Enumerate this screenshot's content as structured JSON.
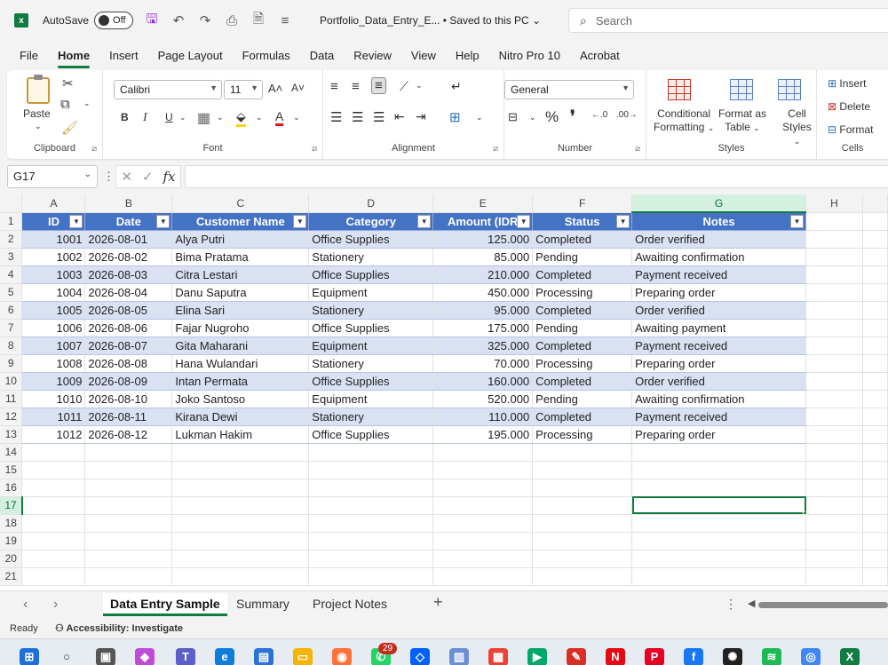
{
  "titlebar": {
    "autosave_label": "AutoSave",
    "autosave_state": "Off",
    "doc_title": "Portfolio_Data_Entry_E... • Saved to this PC",
    "search_placeholder": "Search"
  },
  "menu": [
    "File",
    "Home",
    "Insert",
    "Page Layout",
    "Formulas",
    "Data",
    "Review",
    "View",
    "Help",
    "Nitro Pro 10",
    "Acrobat"
  ],
  "ribbon": {
    "clipboard": {
      "label": "Clipboard",
      "paste": "Paste"
    },
    "font": {
      "label": "Font",
      "family": "Calibri",
      "size": "11",
      "bold": "B",
      "italic": "I",
      "underline": "U",
      "grow": "A˄",
      "shrink": "A˅"
    },
    "alignment": {
      "label": "Alignment"
    },
    "number": {
      "label": "Number",
      "format": "General",
      "percent": "%",
      "comma": "❜"
    },
    "styles": {
      "label": "Styles",
      "conditional": "Conditional",
      "conditional2": "Formatting",
      "format_table": "Format as",
      "format_table2": "Table",
      "cell_styles": "Cell",
      "cell_styles2": "Styles"
    },
    "cells": {
      "label": "Cells",
      "insert": "Insert",
      "delete": "Delete",
      "format": "Format"
    }
  },
  "formula_bar": {
    "name_box": "G17",
    "fx": "fx",
    "value": ""
  },
  "columns": [
    "A",
    "B",
    "C",
    "D",
    "E",
    "F",
    "G",
    "H"
  ],
  "selected_column": "G",
  "selected_row": 17,
  "table": {
    "headers": [
      "ID",
      "Date",
      "Customer Name",
      "Category",
      "Amount (IDR",
      "Status",
      "Notes"
    ],
    "rows": [
      [
        "1001",
        "2026-08-01",
        "Alya Putri",
        "Office Supplies",
        "125.000",
        "Completed",
        "Order verified"
      ],
      [
        "1002",
        "2026-08-02",
        "Bima Pratama",
        "Stationery",
        "85.000",
        "Pending",
        "Awaiting confirmation"
      ],
      [
        "1003",
        "2026-08-03",
        "Citra Lestari",
        "Office Supplies",
        "210.000",
        "Completed",
        "Payment received"
      ],
      [
        "1004",
        "2026-08-04",
        "Danu Saputra",
        "Equipment",
        "450.000",
        "Processing",
        "Preparing order"
      ],
      [
        "1005",
        "2026-08-05",
        "Elina Sari",
        "Stationery",
        "95.000",
        "Completed",
        "Order verified"
      ],
      [
        "1006",
        "2026-08-06",
        "Fajar Nugroho",
        "Office Supplies",
        "175.000",
        "Pending",
        "Awaiting payment"
      ],
      [
        "1007",
        "2026-08-07",
        "Gita Maharani",
        "Equipment",
        "325.000",
        "Completed",
        "Payment received"
      ],
      [
        "1008",
        "2026-08-08",
        "Hana Wulandari",
        "Stationery",
        "70.000",
        "Processing",
        "Preparing order"
      ],
      [
        "1009",
        "2026-08-09",
        "Intan Permata",
        "Office Supplies",
        "160.000",
        "Completed",
        "Order verified"
      ],
      [
        "1010",
        "2026-08-10",
        "Joko Santoso",
        "Equipment",
        "520.000",
        "Pending",
        "Awaiting confirmation"
      ],
      [
        "1011",
        "2026-08-11",
        "Kirana Dewi",
        "Stationery",
        "110.000",
        "Completed",
        "Payment received"
      ],
      [
        "1012",
        "2026-08-12",
        "Lukman Hakim",
        "Office Supplies",
        "195.000",
        "Processing",
        "Preparing order"
      ]
    ]
  },
  "empty_rows": [
    14,
    15,
    16,
    17,
    18,
    19,
    20,
    21
  ],
  "sheet_tabs": [
    "Data Entry Sample",
    "Summary",
    "Project Notes"
  ],
  "active_sheet": "Data Entry Sample",
  "status": {
    "ready": "Ready",
    "accessibility": "Accessibility: Investigate"
  },
  "taskbar": {
    "whatsapp_badge": "29"
  },
  "colors": {
    "accent": "#107c41",
    "table_header": "#4472c4",
    "band": "#d9e1f2"
  }
}
